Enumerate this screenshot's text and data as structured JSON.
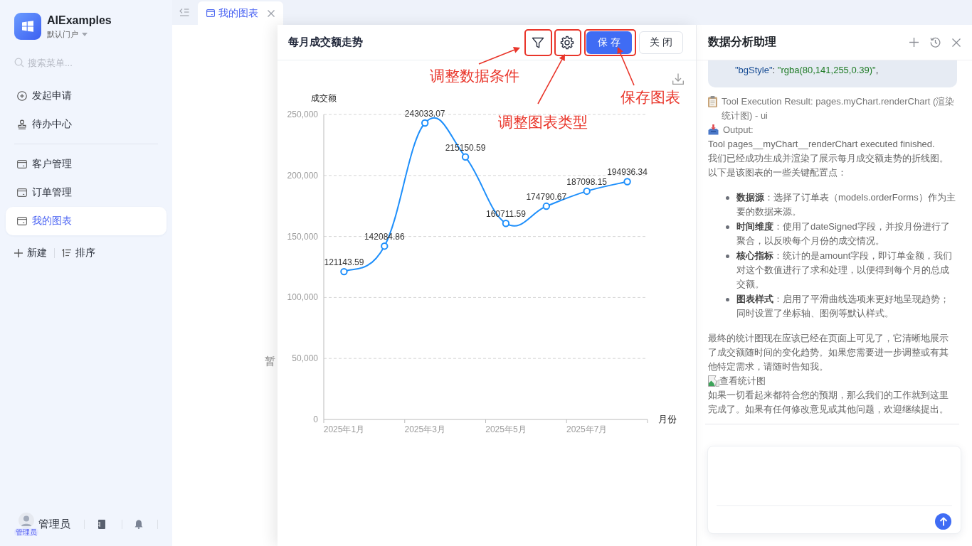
{
  "sidebar": {
    "app_name": "AIExamples",
    "portal": "默认门户",
    "search": {
      "placeholder": "搜索菜单..."
    },
    "menu": [
      {
        "label": "发起申请",
        "kind": "apply",
        "selected": false
      },
      {
        "label": "待办中心",
        "kind": "todo",
        "selected": false
      }
    ],
    "pages": [
      {
        "label": "客户管理",
        "selected": false
      },
      {
        "label": "订单管理",
        "selected": false
      },
      {
        "label": "我的图表",
        "selected": true
      }
    ],
    "actions": [
      {
        "label": "新建",
        "kind": "new"
      },
      {
        "label": "排序",
        "kind": "sort"
      }
    ],
    "user": {
      "name": "管理员",
      "badge": "管理员"
    }
  },
  "tabs": [
    {
      "label": "我的图表",
      "selected": true
    }
  ],
  "main": {
    "empty_text": "暂"
  },
  "chart_panel": {
    "title": "每月成交额走势",
    "buttons": [
      {
        "label": "保存",
        "kind": "primary"
      },
      {
        "label": "关闭",
        "kind": "default"
      }
    ],
    "chart_data": {
      "type": "line",
      "xlabel": "月份",
      "ylabel": "成交额",
      "categories": [
        "2025年1月",
        null,
        "2025年3月",
        null,
        "2025年5月",
        null,
        "2025年7月",
        null
      ],
      "values": [
        121143.59,
        142084.86,
        243033.07,
        215150.59,
        160711.59,
        174790.67,
        187098.15,
        194936.34
      ],
      "ylim": [
        0,
        250000
      ],
      "yticks": [
        0,
        {
          "value": 50000,
          "label": "50,000"
        },
        {
          "value": 100000,
          "label": "100,000"
        },
        {
          "value": 150000,
          "label": "150,000"
        },
        {
          "value": 200000,
          "label": "200,000"
        },
        {
          "value": 250000,
          "label": "250,000"
        }
      ],
      "grid": true,
      "marker": "circle",
      "data_labels": true
    }
  },
  "annotations": [
    {
      "label": "调整数据条件"
    },
    {
      "label": "调整图表类型"
    },
    {
      "label": "保存图表"
    }
  ],
  "assistant": {
    "title": "数据分析助理",
    "code_line": [
      {
        "kind": "key",
        "text": "\"bgStyle\""
      },
      {
        "kind": "punct",
        "text": ": "
      },
      {
        "kind": "string",
        "text": "\"rgba(80,141,255,0.39)\""
      },
      {
        "kind": "punct",
        "text": ","
      }
    ],
    "messages": [
      {
        "kind": "tool",
        "text": "Tool Execution Result: pages.myChart.renderChart (渲染统计图) - ui"
      },
      {
        "kind": "output",
        "text": "Output:"
      },
      {
        "kind": "text",
        "text": "Tool pages__myChart__renderChart executed finished."
      },
      {
        "kind": "text",
        "text": "我们已经成功生成并渲染了展示每月成交额走势的折线图。"
      },
      {
        "kind": "text",
        "text": "以下是该图表的一些关键配置点："
      },
      {
        "kind": "list",
        "items": [
          "**数据源**：选择了订单表（models.orderForms）作为主要的数据来源。",
          "**时间维度**：使用了dateSigned字段，并按月份进行了聚合，以反映每个月份的成交情况。",
          "**核心指标**：统计的是amount字段，即订单金额，我们对这个数值进行了求和处理，以便得到每个月的总成交额。",
          "**图表样式**：启用了平滑曲线选项来更好地呈现趋势；同时设置了坐标轴、图例等默认样式。"
        ]
      },
      {
        "kind": "text",
        "text": "最终的统计图现在应该已经在页面上可见了，它清晰地展示了成交额随时间的变化趋势。如果您需要进一步调整或有其他特定需求，请随时告知我。"
      },
      {
        "kind": "image",
        "alt": "查看统计图"
      },
      {
        "kind": "text",
        "text": "如果一切看起来都符合您的预期，那么我们的工作就到这里完成了。如果有任何修改意见或其他问题，欢迎继续提出。"
      }
    ]
  }
}
